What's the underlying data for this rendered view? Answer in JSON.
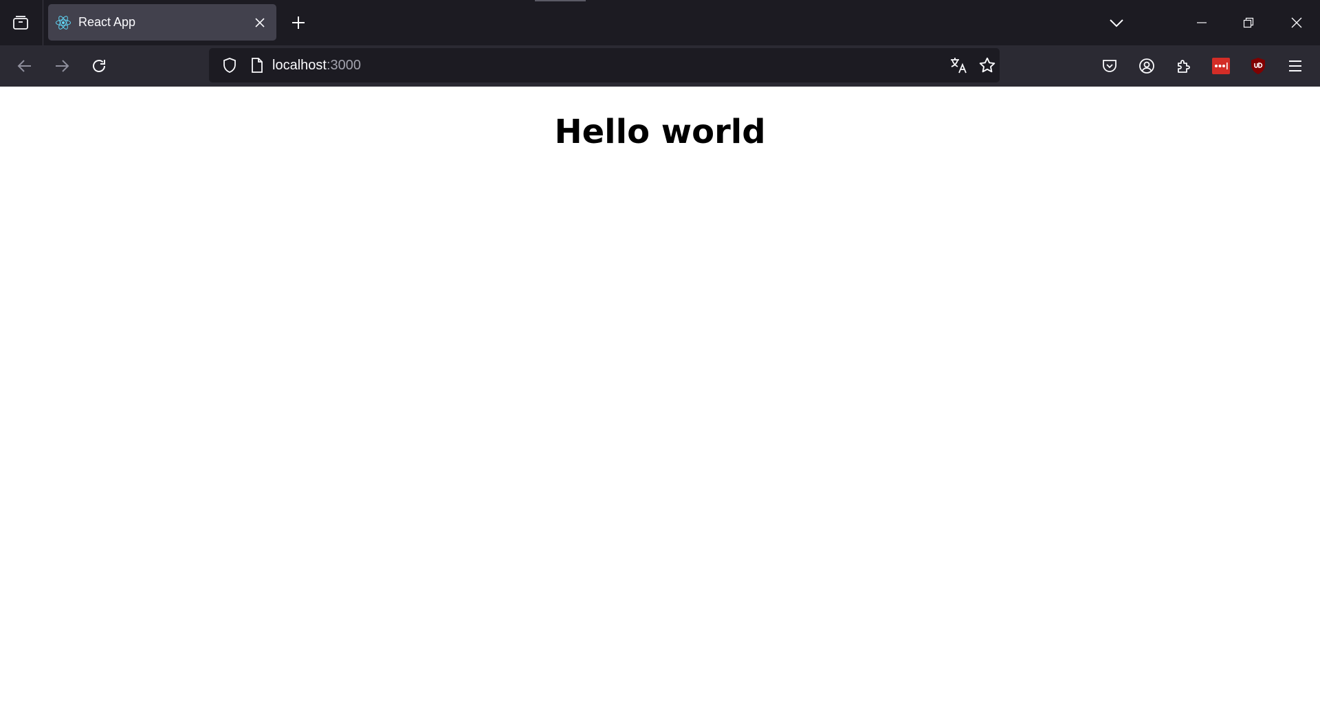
{
  "browser": {
    "tab": {
      "title": "React App",
      "favicon": "react-logo-icon"
    },
    "url": {
      "host": "localhost",
      "port": ":3000"
    },
    "colors": {
      "chrome_dark": "#1c1b22",
      "toolbar": "#2b2a33",
      "active_tab": "#42414d",
      "lastpass_red": "#d32d27",
      "ublock_red": "#800000",
      "react_cyan": "#61dafb"
    }
  },
  "page": {
    "heading": "Hello world"
  }
}
